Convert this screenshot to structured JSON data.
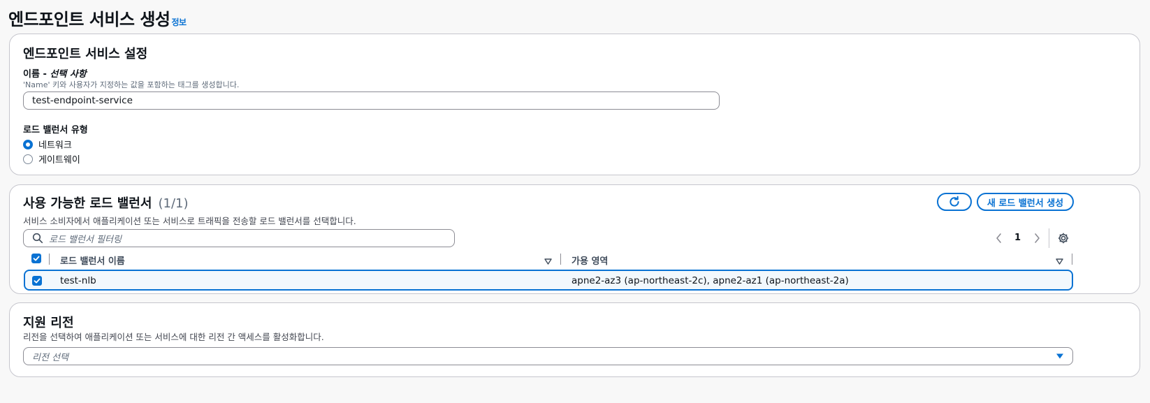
{
  "page": {
    "title": "엔드포인트 서비스 생성",
    "info_link": "정보"
  },
  "settings": {
    "title": "엔드포인트 서비스 설정",
    "name_label": "이름",
    "name_optional": "선택 사항",
    "name_hint": "'Name' 키와 사용자가 지정하는 값을 포함하는 태그를 생성합니다.",
    "name_value": "test-endpoint-service",
    "lb_type_label": "로드 밸런서 유형",
    "lb_type_options": [
      {
        "label": "네트워크",
        "checked": true
      },
      {
        "label": "게이트웨이",
        "checked": false
      }
    ]
  },
  "available_lbs": {
    "title": "사용 가능한 로드 밸런서",
    "count": "(1/1)",
    "description": "서비스 소비자에서 애플리케이션 또는 서비스로 트래픽을 전송할 로드 밸런서를 선택합니다.",
    "create_button": "새 로드 밸런서 생성",
    "filter_placeholder": "로드 밸런서 필터링",
    "current_page": "1",
    "columns": [
      "로드 밸런서 이름",
      "가용 영역"
    ],
    "rows": [
      {
        "name": "test-nlb",
        "az": "apne2-az3 (ap-northeast-2c), apne2-az1 (ap-northeast-2a)",
        "selected": true
      }
    ]
  },
  "regions": {
    "title": "지원 리전",
    "description": "리전을 선택하여 애플리케이션 또는 서비스에 대한 리전 간 액세스를 활성화합니다.",
    "select_placeholder": "리전 선택"
  },
  "colors": {
    "accent": "#0972d3",
    "border": "#c6c6cd",
    "background": "#f8f8f8"
  }
}
